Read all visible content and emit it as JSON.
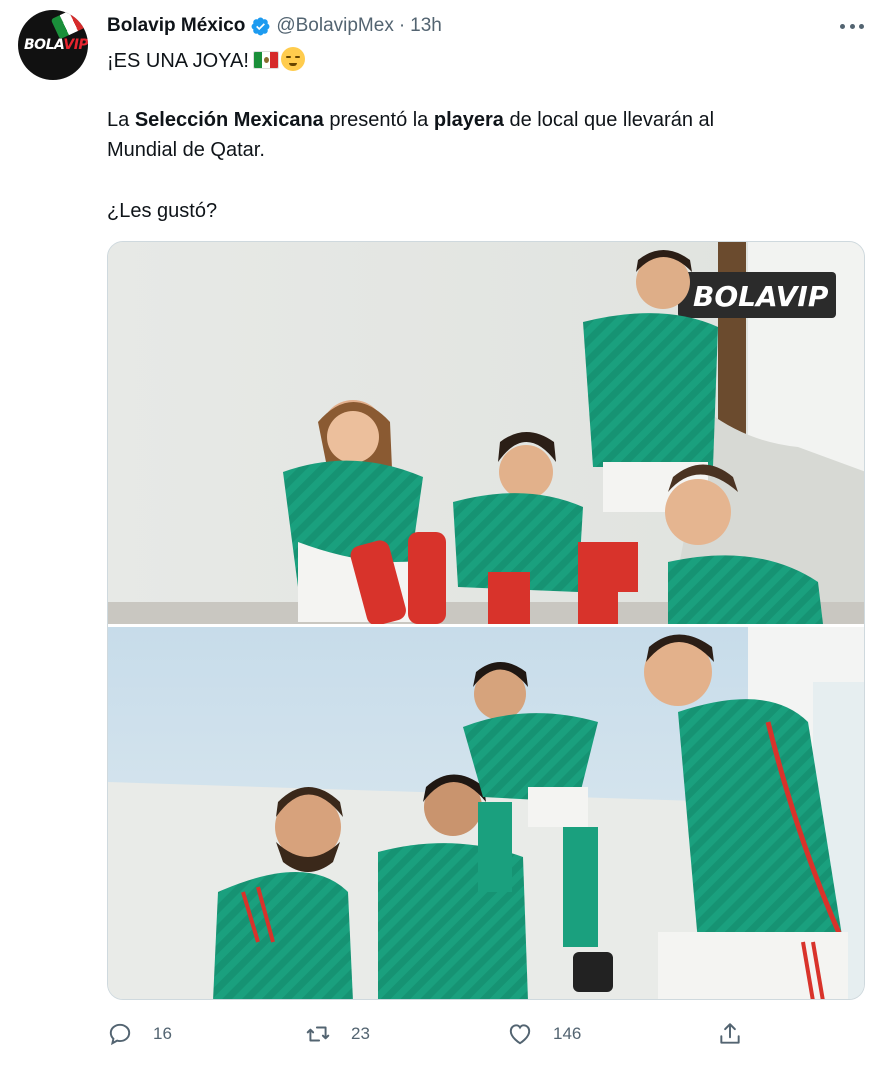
{
  "tweet": {
    "author_name": "Bolavip México",
    "handle": "@BolavipMex",
    "separator": "·",
    "time": "13h",
    "avatar_logo": {
      "part1": "BOLA",
      "part2": "VIP"
    },
    "line1": "¡ES UNA JOYA!",
    "body_1": "La ",
    "body_bold_1": "Selección Mexicana",
    "body_2": " presentó la ",
    "body_bold_2": "playera",
    "body_3": " de local que llevarán al",
    "body_4": "Mundial de Qatar.",
    "question": "¿Les gustó?",
    "watermark": "BOLAVIP"
  },
  "actions": {
    "reply_count": "16",
    "retweet_count": "23",
    "like_count": "146"
  },
  "colors": {
    "text": "#0f1419",
    "secondary": "#536471",
    "verified": "#1d9bf0",
    "jersey_green": "#1aa07e",
    "sock_red": "#d8332b"
  },
  "icons": [
    "more-icon",
    "verified-icon",
    "reply-icon",
    "retweet-icon",
    "like-icon",
    "share-icon"
  ]
}
